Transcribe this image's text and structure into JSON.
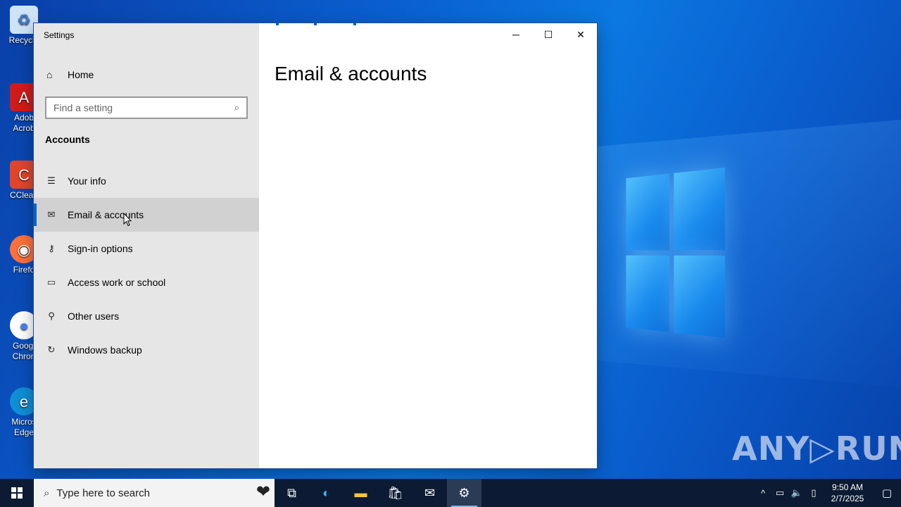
{
  "window": {
    "app_title": "Settings",
    "page_heading": "Email & accounts",
    "controls": {
      "minimize": "─",
      "maximize": "☐",
      "close": "✕"
    }
  },
  "sidebar": {
    "home_label": "Home",
    "search_placeholder": "Find a setting",
    "section_title": "Accounts",
    "items": [
      {
        "label": "Your info",
        "icon": "contact-card-icon"
      },
      {
        "label": "Email & accounts",
        "icon": "mail-icon",
        "active": true
      },
      {
        "label": "Sign-in options",
        "icon": "key-icon"
      },
      {
        "label": "Access work or school",
        "icon": "briefcase-icon"
      },
      {
        "label": "Other users",
        "icon": "person-add-icon"
      },
      {
        "label": "Windows backup",
        "icon": "sync-icon"
      }
    ]
  },
  "desktop": {
    "icons": [
      "Recycle",
      "Adob Acrob",
      "CClean",
      "Firefo",
      "Googl Chron",
      "Micros Edge"
    ],
    "watermark": "ANY▷RUN"
  },
  "taskbar": {
    "search_placeholder": "Type here to search",
    "time": "9:50 AM",
    "date": "2/7/2025"
  },
  "colors": {
    "accent": "#0067c0",
    "taskbar": "#0c1b33",
    "sidebar": "#e6e6e6"
  }
}
